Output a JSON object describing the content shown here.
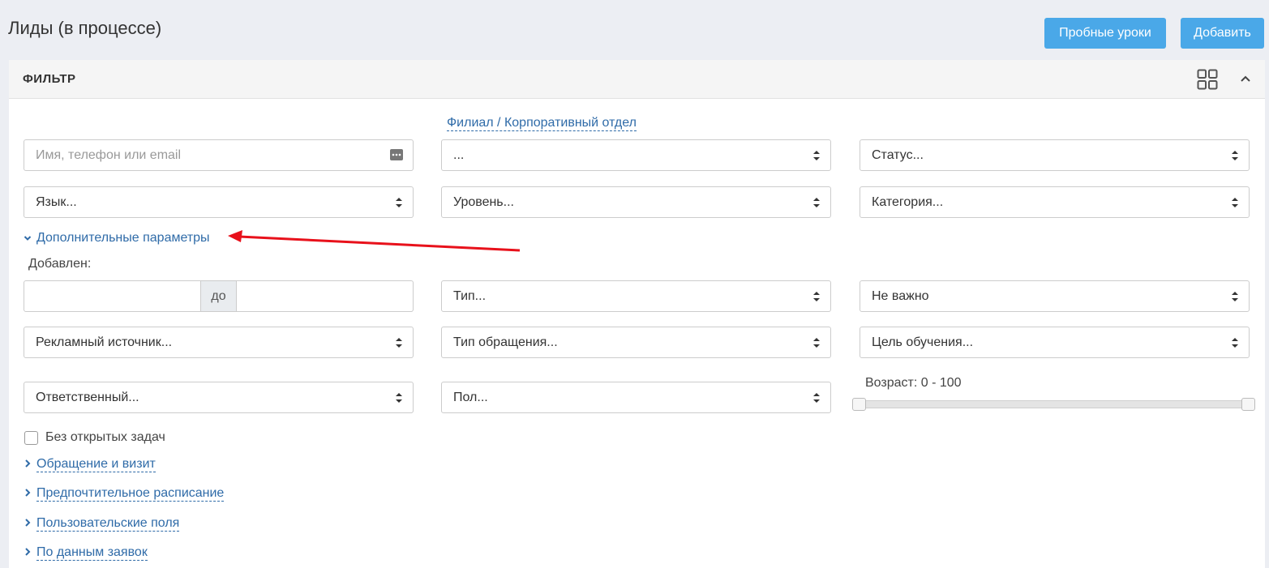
{
  "page": {
    "title": "Лиды (в процессе)"
  },
  "header_buttons": {
    "trial_lessons": "Пробные уроки",
    "add": "Добавить"
  },
  "filter": {
    "title": "ФИЛЬТР",
    "branch_link": "Филиал / Корпоративный отдел",
    "search_placeholder": "Имя, телефон или email",
    "branch_value": "...",
    "status": "Статус...",
    "language": "Язык...",
    "level": "Уровень...",
    "category": "Категория...",
    "additional_params": "Дополнительные параметры",
    "added_label": "Добавлен:",
    "date_sep": "до",
    "type": "Тип...",
    "not_important": "Не важно",
    "ad_source": "Рекламный источник...",
    "request_type": "Тип обращения...",
    "learning_goal": "Цель обучения...",
    "responsible": "Ответственный...",
    "gender": "Пол...",
    "age_label": "Возраст: 0 - 100",
    "age_range": {
      "min": 0,
      "max": 100,
      "from": 0,
      "to": 100
    },
    "no_open_tasks": "Без открытых задач",
    "sections": [
      "Обращение и визит",
      "Предпочтительное расписание",
      "Пользовательские поля",
      "По данным заявок"
    ]
  },
  "colors": {
    "accent": "#4aa8e8",
    "link": "#2f6ba8",
    "annotation_arrow": "#e8111b"
  }
}
